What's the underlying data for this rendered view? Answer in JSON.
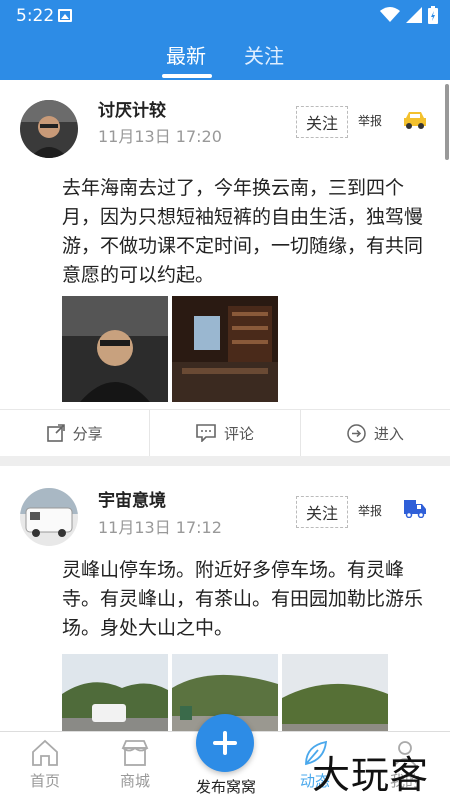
{
  "status_bar": {
    "time": "5:22"
  },
  "top_tabs": [
    {
      "label": "最新",
      "active": true
    },
    {
      "label": "关注",
      "active": false
    }
  ],
  "posts": [
    {
      "username": "讨厌计较",
      "time": "11月13日 17:20",
      "follow_label": "关注",
      "report_label": "举报",
      "badge_icon": "car-icon",
      "text": "去年海南去过了，今年换云南，三到四个月，因为只想短袖短裤的自由生活，独驾慢游，不做功课不定时间，一切随缘，有共同意愿的可以约起。",
      "actions": {
        "share": "分享",
        "comment": "评论",
        "enter": "进入"
      }
    },
    {
      "username": "宇宙意境",
      "time": "11月13日 17:12",
      "follow_label": "关注",
      "report_label": "举报",
      "badge_icon": "rv-icon",
      "text": "灵峰山停车场。附近好多停车场。有灵峰寺。有灵峰山，有茶山。有田园加勒比游乐场。身处大山之中。"
    }
  ],
  "bottom_nav": {
    "home": "首页",
    "mall": "商城",
    "publish": "发布窝窝",
    "dynamic": "动态",
    "mine": "我的"
  },
  "watermark": "大玩客",
  "colors": {
    "brand_blue": "#2d8ce6",
    "badge_yellow": "#f3c12e",
    "badge_blue": "#2f5fd8"
  }
}
